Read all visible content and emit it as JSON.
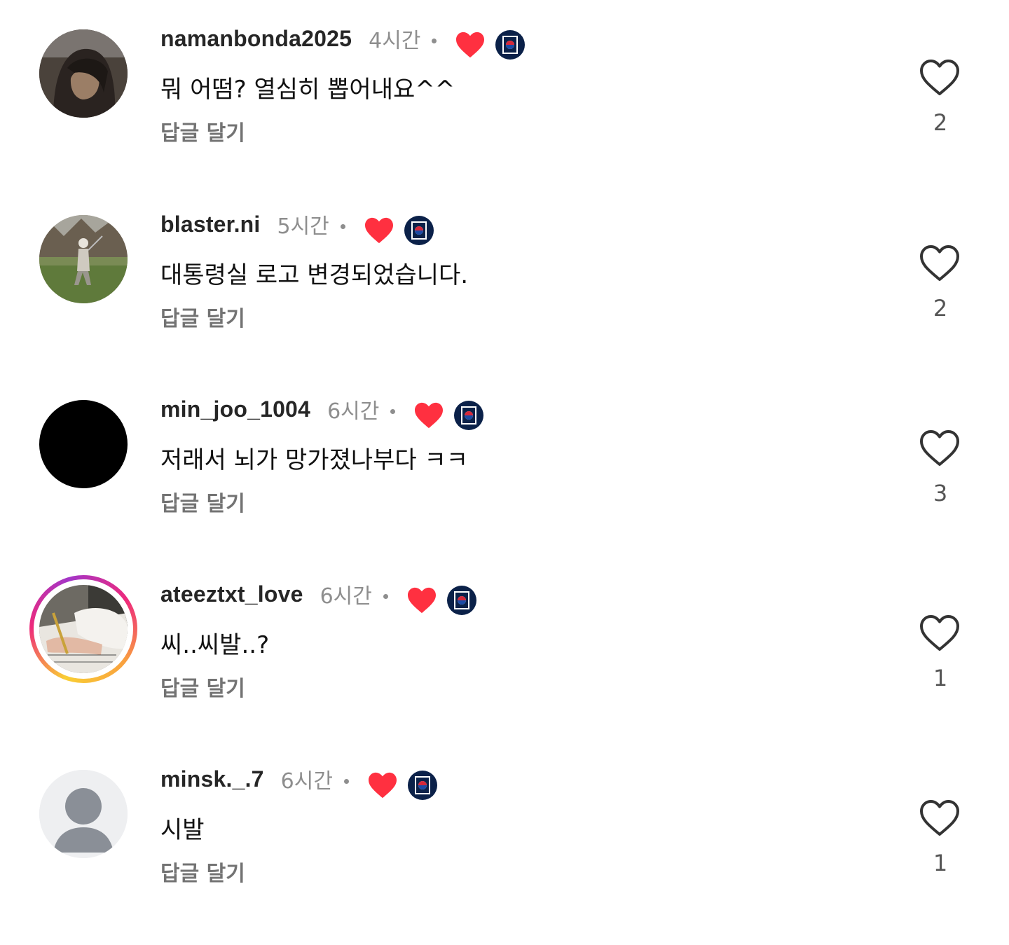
{
  "comments": [
    {
      "username": "namanbonda2025",
      "time": "4시간",
      "text": "뭐 어떰? 열심히 뽑어내요^^",
      "reply": "답글 달기",
      "likes": "2",
      "avatar": "dark-illustration-avatar"
    },
    {
      "username": "blaster.ni",
      "time": "5시간",
      "text": "대통령실 로고 변경되었습니다.",
      "reply": "답글 달기",
      "likes": "2",
      "avatar": "golf-photo-avatar"
    },
    {
      "username": "min_joo_1004",
      "time": "6시간",
      "text": "저래서 뇌가 망가졌나부다 ㅋㅋ",
      "reply": "답글 달기",
      "likes": "3",
      "avatar": "black-avatar"
    },
    {
      "username": "ateeztxt_love",
      "time": "6시간",
      "text": "씨..씨발..?",
      "reply": "답글 달기",
      "likes": "1",
      "avatar": "story-ring-writing-photo-avatar"
    },
    {
      "username": "minsk._.7",
      "time": "6시간",
      "text": "시발",
      "reply": "답글 달기",
      "likes": "1",
      "avatar": "default-person-avatar"
    }
  ],
  "colors": {
    "creator_heart": "#ff3040",
    "badge_navy": "#0b2149",
    "username": "#262626",
    "secondary": "#8e8e8e"
  }
}
